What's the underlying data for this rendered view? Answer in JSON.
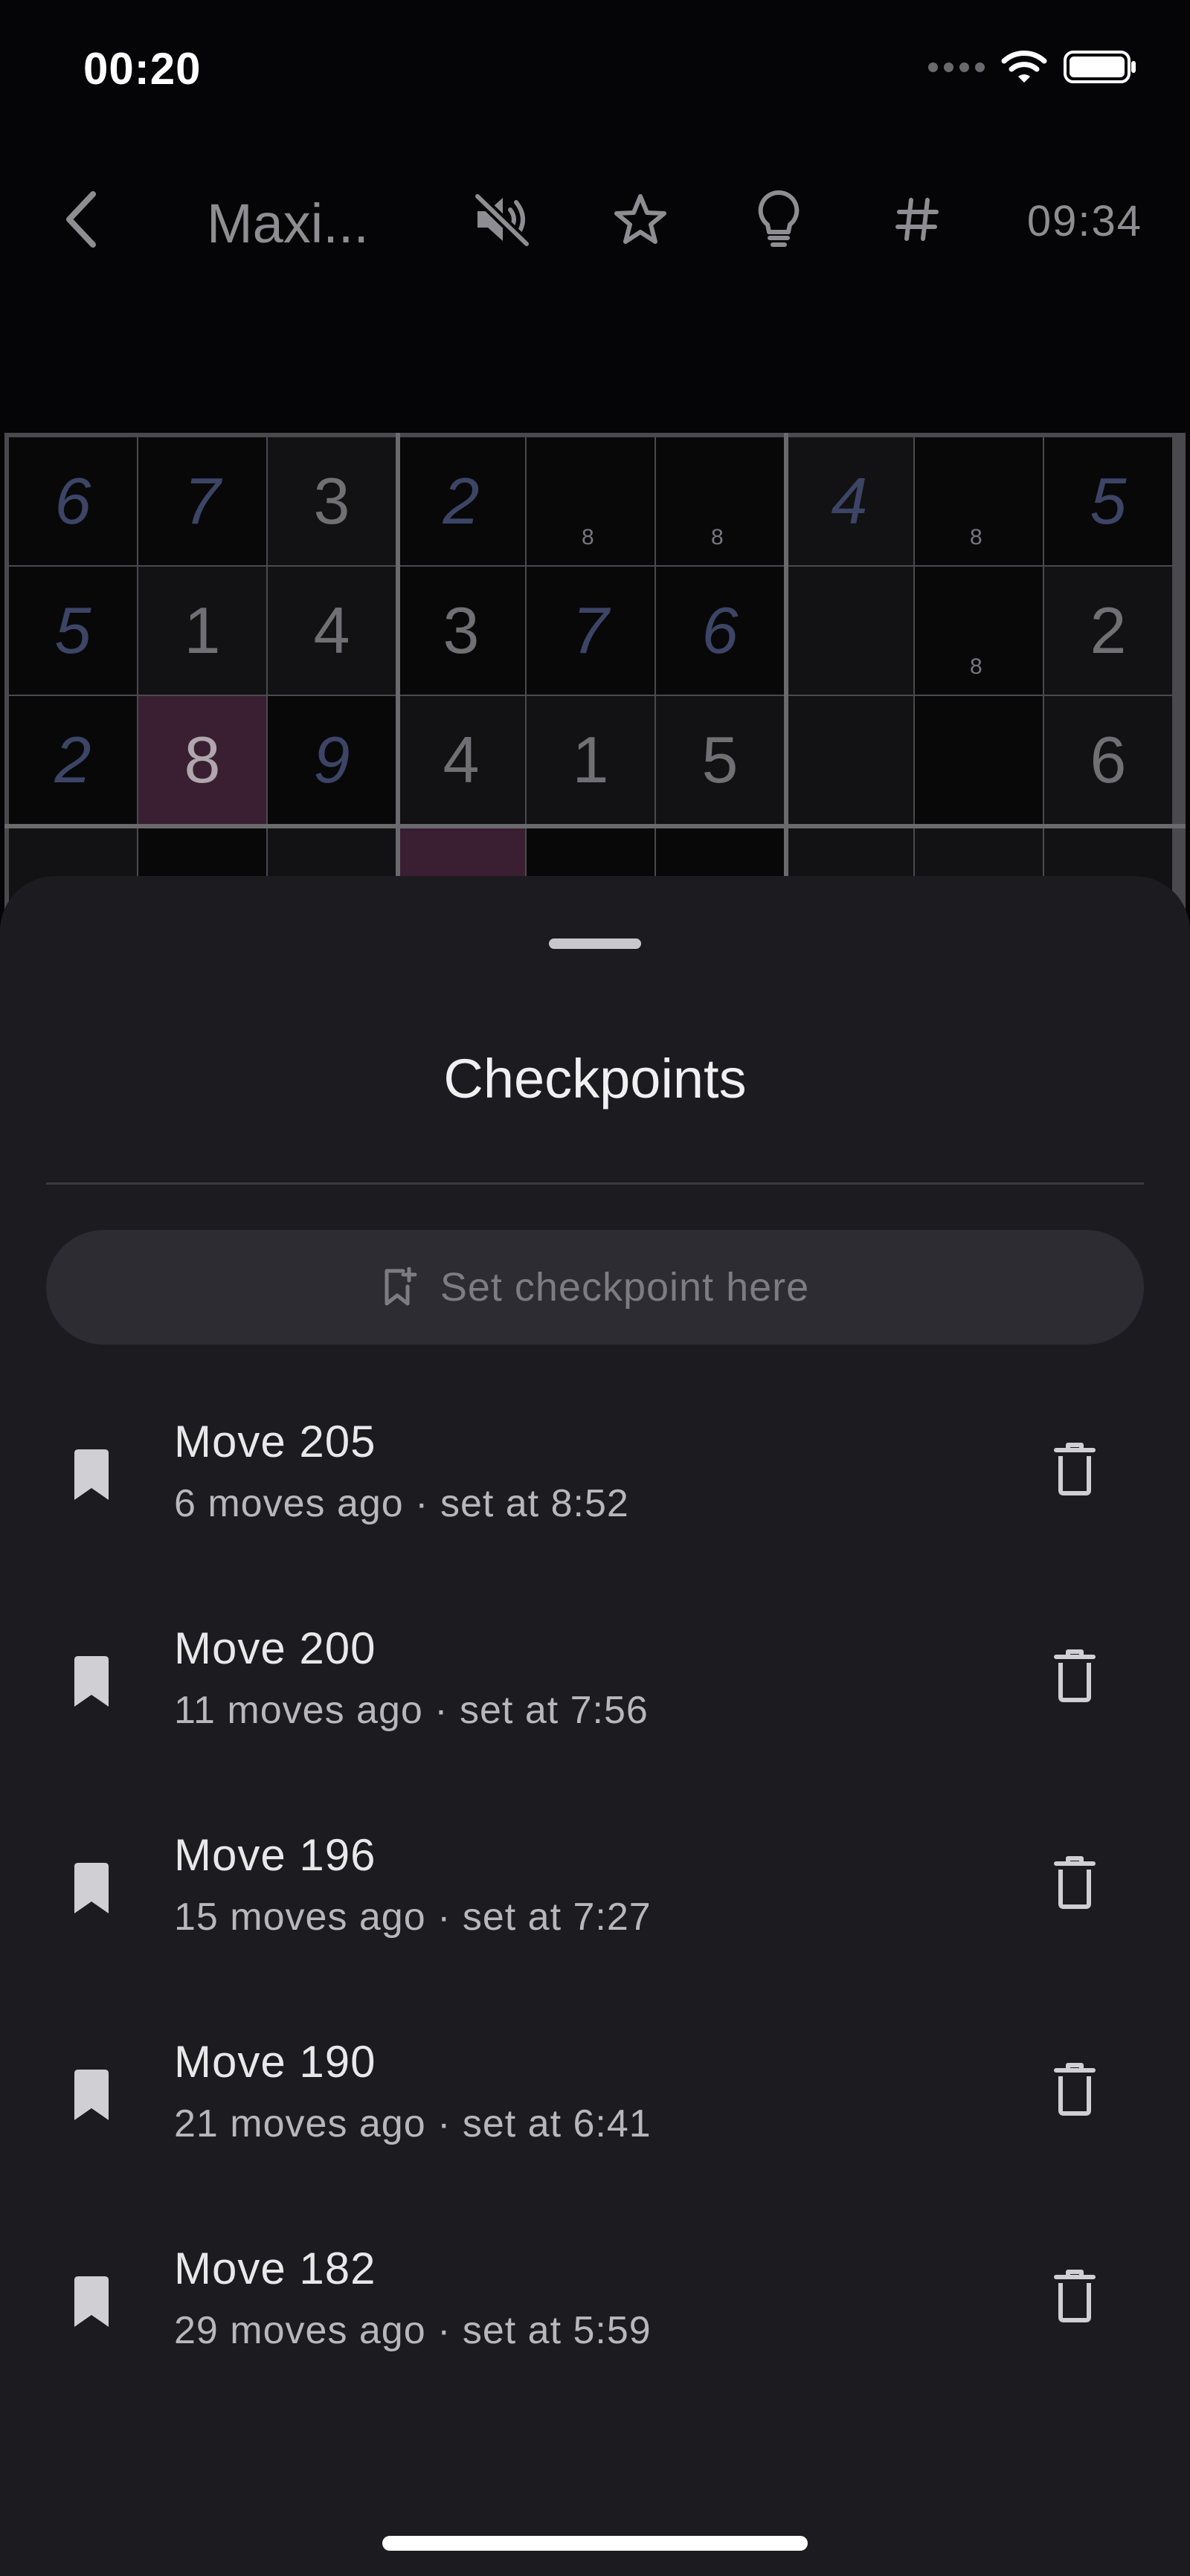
{
  "status_bar": {
    "time": "00:20"
  },
  "app_bar": {
    "title": "Maxi...",
    "timer": "09:34"
  },
  "board_rows": [
    [
      "6",
      "7",
      "3",
      "2",
      "",
      "",
      "4",
      "",
      "5"
    ],
    [
      "5",
      "1",
      "4",
      "3",
      "7",
      "6",
      "",
      "",
      "2"
    ],
    [
      "2",
      "8",
      "9",
      "4",
      "1",
      "5",
      "",
      "",
      "6"
    ]
  ],
  "sheet": {
    "title": "Checkpoints",
    "set_checkpoint_label": "Set checkpoint here",
    "checkpoints": [
      {
        "name": "Move 205",
        "meta": "6 moves ago · set at 8:52"
      },
      {
        "name": "Move 200",
        "meta": "11 moves ago · set at 7:56"
      },
      {
        "name": "Move 196",
        "meta": "15 moves ago · set at 7:27"
      },
      {
        "name": "Move 190",
        "meta": "21 moves ago · set at 6:41"
      },
      {
        "name": "Move 182",
        "meta": "29 moves ago · set at 5:59"
      }
    ]
  },
  "icons": {
    "back": "chevron-left-icon",
    "mute": "volume-off-icon",
    "favorite": "star-outline-icon",
    "hint": "lightbulb-icon",
    "notes": "hash-icon",
    "set_checkpoint": "bookmark-add-icon",
    "checkpoint": "bookmark-icon",
    "delete": "trash-icon"
  },
  "colors": {
    "sheet_background": "#1b1b20",
    "highlight_cell": "#3a1f32",
    "user_digit": "#3c4566"
  }
}
